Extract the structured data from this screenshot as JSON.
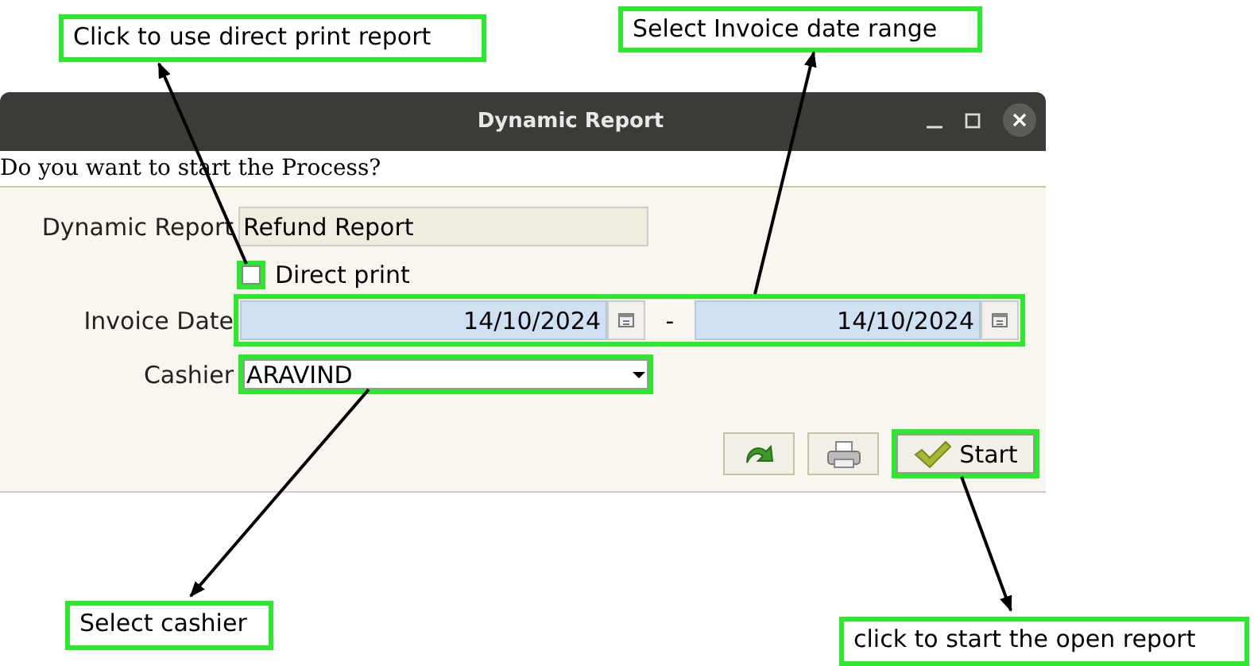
{
  "window": {
    "title": "Dynamic Report",
    "prompt": "Do you want to start the Process?"
  },
  "form": {
    "report": {
      "label": "Dynamic Report",
      "value": "Refund Report"
    },
    "direct_print": {
      "label": "Direct print",
      "checked": false,
      "highlighted": true
    },
    "invoice_date": {
      "label": "Invoice Date",
      "from": "14/10/2024",
      "separator": "-",
      "to": "14/10/2024",
      "highlighted": true
    },
    "cashier": {
      "label": "Cashier",
      "value": "ARAVIND",
      "highlighted": true
    }
  },
  "buttons": [
    {
      "kind": "refresh",
      "highlighted": false
    },
    {
      "kind": "print",
      "highlighted": false
    },
    {
      "kind": "start",
      "label": "Start",
      "highlighted": true
    }
  ],
  "annotations": [
    {
      "text": "Click to use direct print report"
    },
    {
      "text": "Select Invoice date range"
    },
    {
      "text": "Select cashier"
    },
    {
      "text": "click to start the open report"
    }
  ]
}
